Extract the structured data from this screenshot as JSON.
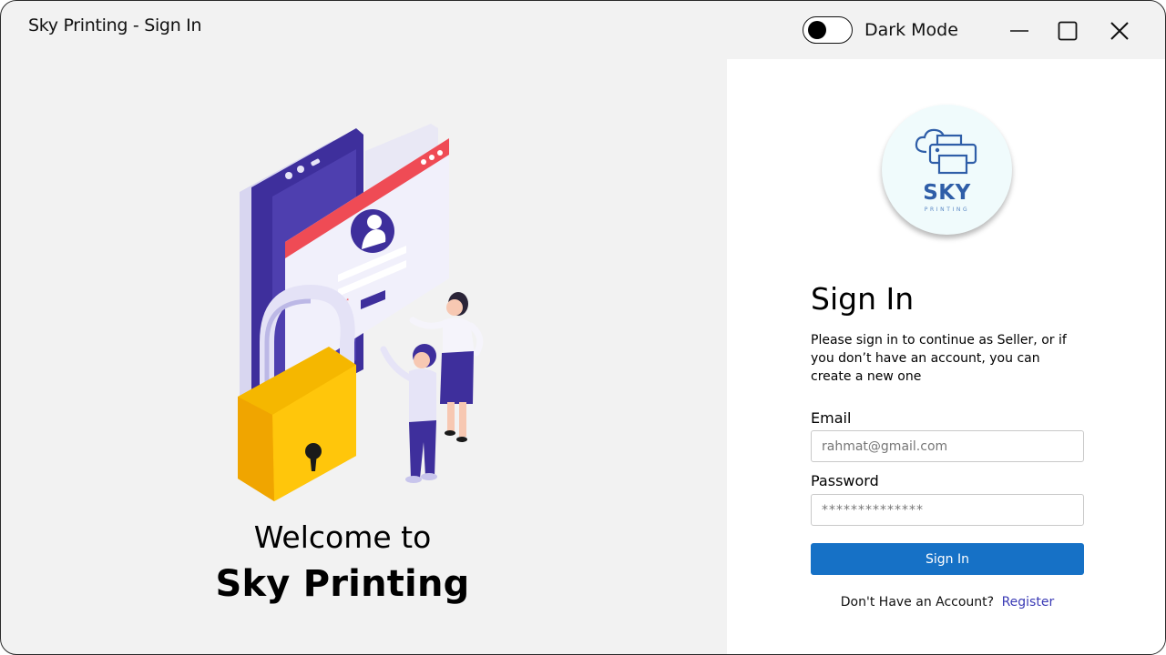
{
  "window": {
    "title": "Sky Printing - Sign In",
    "dark_mode_label": "Dark Mode",
    "dark_mode_on": false
  },
  "welcome": {
    "line1": "Welcome to",
    "line2": "Sky Printing"
  },
  "logo": {
    "word": "SKY",
    "sub": "PRINTING",
    "icon": "cloud-printer-icon"
  },
  "signin": {
    "title": "Sign In",
    "description": "Please sign in to continue as Seller, or if you don’t have an account, you can create a new one",
    "email_label": "Email",
    "email_placeholder": "rahmat@gmail.com",
    "password_label": "Password",
    "password_placeholder": "**************",
    "button_label": "Sign In",
    "no_account_text": "Don't Have an Account?",
    "register_label": "Register"
  },
  "colors": {
    "accent": "#1671c6",
    "link": "#3a3ab5",
    "panel_bg": "#ffffff",
    "window_bg": "#f2f2f2"
  }
}
